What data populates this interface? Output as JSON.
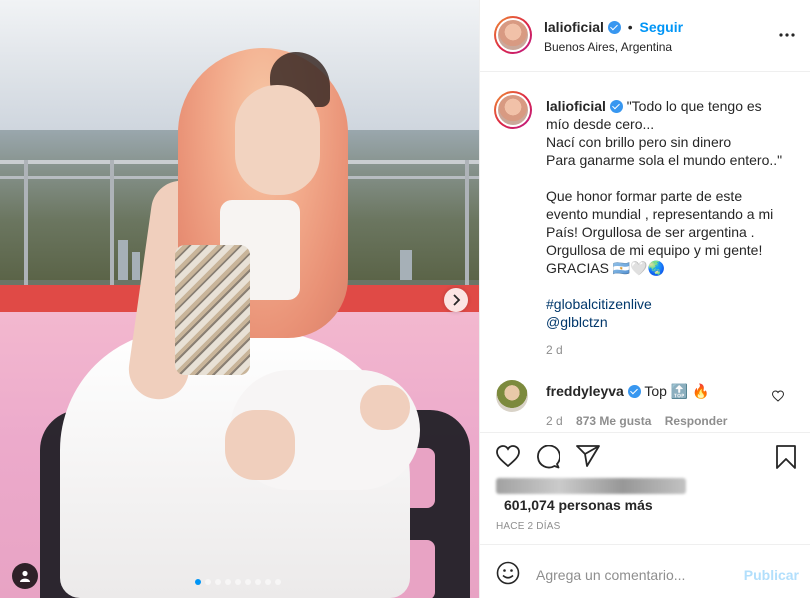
{
  "post": {
    "username": "lalioficial",
    "follow_label": "Seguir",
    "separator": "•",
    "location": "Buenos Aires, Argentina",
    "more_label": "•••",
    "carousel_dot_count": 9,
    "carousel_active_index": 0
  },
  "caption": {
    "username": "lalioficial",
    "lines": [
      "\"Todo lo que tengo es",
      "mío desde cero...",
      "Nací con brillo pero sin dinero",
      "Para ganarme sola el mundo entero..\"",
      "",
      "Que honor formar parte de este",
      "evento mundial , representando a mi",
      "País! Orgullosa de ser argentina .",
      "Orgullosa de mi equipo y mi gente!",
      "GRACIAS 🇦🇷🤍🌏"
    ],
    "hashtag": "#globalcitizenlive",
    "mention": "@glblctzn",
    "time": "2 d"
  },
  "comment": {
    "username": "freddyleyva",
    "text": "Top 🔝 🔥",
    "time": "2 d",
    "likes": "873 Me gusta",
    "reply_label": "Responder"
  },
  "likes": {
    "count_text": "601,074 personas más"
  },
  "posted_ago": "HACE 2 DÍAS",
  "add_comment": {
    "placeholder": "Agrega un comentario...",
    "publish_label": "Publicar"
  },
  "colors": {
    "accent": "#0095f6",
    "verified": "#3897f0",
    "muted": "#8e8e8e",
    "publish_disabled": "#b2dffc"
  }
}
